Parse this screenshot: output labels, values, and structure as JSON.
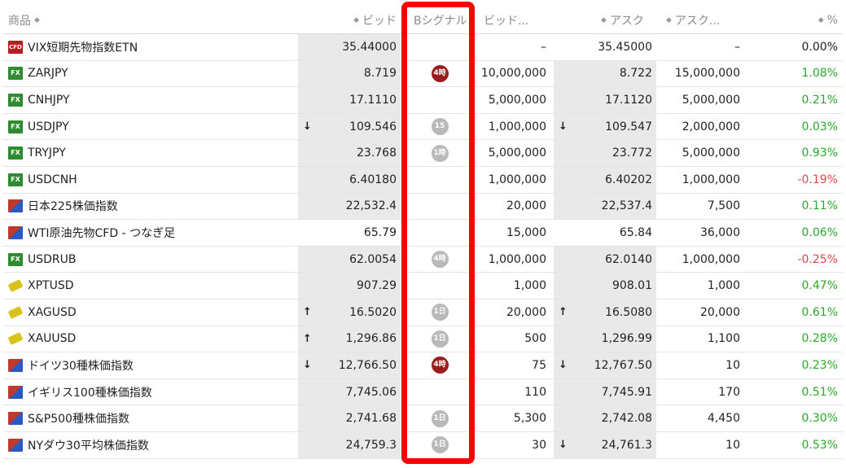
{
  "header": {
    "name": "商品",
    "bid": "ビッド",
    "signal": "Bシグナル",
    "bid_vol": "ビッド...",
    "ask": "アスク",
    "ask_vol": "アスク...",
    "pct": "%"
  },
  "rows": [
    {
      "icon": "cfd",
      "name": "VIX短期先物指数ETN",
      "bid_arrow": "",
      "bid": "35.44000",
      "signal": "",
      "bid_vol": "–",
      "ask_arrow": "",
      "ask": "35.45000",
      "ask_vol": "–",
      "pct": "0.00%",
      "pct_color": "neutral"
    },
    {
      "icon": "fx",
      "name": "ZARJPY",
      "bid_arrow": "",
      "bid": "8.719",
      "signal": "4時",
      "signal_color": "red",
      "bid_vol": "10,000,000",
      "ask_arrow": "",
      "ask": "8.722",
      "ask_vol": "15,000,000",
      "pct": "1.08%",
      "pct_color": "green"
    },
    {
      "icon": "fx",
      "name": "CNHJPY",
      "bid_arrow": "",
      "bid": "17.1110",
      "signal": "",
      "bid_vol": "5,000,000",
      "ask_arrow": "",
      "ask": "17.1120",
      "ask_vol": "5,000,000",
      "pct": "0.21%",
      "pct_color": "green"
    },
    {
      "icon": "fx",
      "name": "USDJPY",
      "bid_arrow": "↓",
      "bid": "109.546",
      "signal": "15",
      "signal_color": "gray",
      "bid_vol": "1,000,000",
      "ask_arrow": "↓",
      "ask": "109.547",
      "ask_vol": "2,000,000",
      "pct": "0.03%",
      "pct_color": "green"
    },
    {
      "icon": "fx",
      "name": "TRYJPY",
      "bid_arrow": "",
      "bid": "23.768",
      "signal": "1時",
      "signal_color": "gray",
      "bid_vol": "5,000,000",
      "ask_arrow": "",
      "ask": "23.772",
      "ask_vol": "5,000,000",
      "pct": "0.93%",
      "pct_color": "green"
    },
    {
      "icon": "fx",
      "name": "USDCNH",
      "bid_arrow": "",
      "bid": "6.40180",
      "signal": "",
      "bid_vol": "1,000,000",
      "ask_arrow": "",
      "ask": "6.40202",
      "ask_vol": "1,000,000",
      "pct": "-0.19%",
      "pct_color": "red"
    },
    {
      "icon": "cfdi",
      "name": "日本225株価指数",
      "bid_arrow": "",
      "bid": "22,532.4",
      "signal": "",
      "bid_vol": "20,000",
      "ask_arrow": "",
      "ask": "22,537.4",
      "ask_vol": "7,500",
      "pct": "0.11%",
      "pct_color": "green"
    },
    {
      "icon": "cfdi",
      "name": "WTI原油先物CFD - つなぎ足",
      "bid_arrow": "",
      "bid": "65.79",
      "signal": "",
      "bid_vol": "15,000",
      "ask_arrow": "",
      "ask": "65.84",
      "ask_vol": "36,000",
      "pct": "0.06%",
      "pct_color": "green"
    },
    {
      "icon": "fx",
      "name": "USDRUB",
      "bid_arrow": "",
      "bid": "62.0054",
      "signal": "4時",
      "signal_color": "gray",
      "bid_vol": "1,000,000",
      "ask_arrow": "",
      "ask": "62.0140",
      "ask_vol": "1,000,000",
      "pct": "-0.25%",
      "pct_color": "red"
    },
    {
      "icon": "gold",
      "name": "XPTUSD",
      "bid_arrow": "",
      "bid": "907.29",
      "signal": "",
      "bid_vol": "1,000",
      "ask_arrow": "",
      "ask": "908.01",
      "ask_vol": "1,000",
      "pct": "0.47%",
      "pct_color": "green"
    },
    {
      "icon": "gold",
      "name": "XAGUSD",
      "bid_arrow": "↑",
      "bid": "16.5020",
      "signal": "1日",
      "signal_color": "gray",
      "bid_vol": "20,000",
      "ask_arrow": "↑",
      "ask": "16.5080",
      "ask_vol": "20,000",
      "pct": "0.61%",
      "pct_color": "green"
    },
    {
      "icon": "gold",
      "name": "XAUUSD",
      "bid_arrow": "↑",
      "bid": "1,296.86",
      "signal": "1日",
      "signal_color": "gray",
      "bid_vol": "500",
      "ask_arrow": "",
      "ask": "1,296.99",
      "ask_vol": "1,100",
      "pct": "0.28%",
      "pct_color": "green"
    },
    {
      "icon": "cfdi",
      "name": "ドイツ30種株価指数",
      "bid_arrow": "↓",
      "bid": "12,766.50",
      "signal": "4時",
      "signal_color": "red",
      "bid_vol": "75",
      "ask_arrow": "↓",
      "ask": "12,767.50",
      "ask_vol": "10",
      "pct": "0.23%",
      "pct_color": "green"
    },
    {
      "icon": "cfdi",
      "name": "イギリス100種株価指数",
      "bid_arrow": "",
      "bid": "7,745.06",
      "signal": "",
      "bid_vol": "110",
      "ask_arrow": "",
      "ask": "7,745.91",
      "ask_vol": "170",
      "pct": "0.51%",
      "pct_color": "green"
    },
    {
      "icon": "cfdi",
      "name": "S&P500種株価指数",
      "bid_arrow": "",
      "bid": "2,741.68",
      "signal": "1日",
      "signal_color": "gray",
      "bid_vol": "5,300",
      "ask_arrow": "",
      "ask": "2,742.08",
      "ask_vol": "4,450",
      "pct": "0.30%",
      "pct_color": "green"
    },
    {
      "icon": "cfdi",
      "name": "NYダウ30平均株価指数",
      "bid_arrow": "",
      "bid": "24,759.3",
      "signal": "1日",
      "signal_color": "gray",
      "bid_vol": "30",
      "ask_arrow": "↓",
      "ask": "24,761.3",
      "ask_vol": "10",
      "pct": "0.53%",
      "pct_color": "green"
    }
  ],
  "icons": {
    "cfd": "CFD",
    "fx": "FX",
    "cfdi": "",
    "gold": ""
  },
  "colors": {
    "highlight": "#ff0000",
    "green": "#2aa82a",
    "red": "#e04848",
    "signal_red": "#9b1c1c",
    "signal_gray": "#b9b9b9"
  }
}
